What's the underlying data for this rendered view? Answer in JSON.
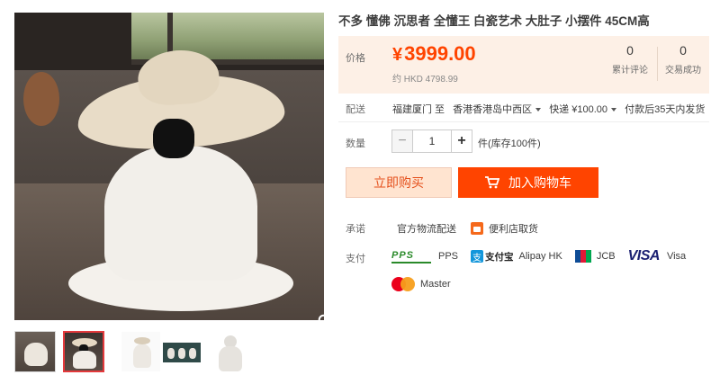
{
  "product": {
    "title": "不多 懂佛 沉思者 全懂王 白瓷艺术 大肚子 小摆件 45CM高"
  },
  "price_box": {
    "label": "价格",
    "currency": "¥",
    "price": "3999.00",
    "sub_price": "约 HKD 4798.99",
    "reviews_count": "0",
    "reviews_label": "累计评论",
    "sales_count": "0",
    "sales_label": "交易成功"
  },
  "shipping": {
    "label": "配送",
    "from": "福建厦门 至",
    "to": "香港香港岛中西区",
    "express": "快递 ¥100.00",
    "dispatch": "付款后35天内发货"
  },
  "quantity": {
    "label": "数量",
    "minus": "−",
    "value": "1",
    "plus": "+",
    "stock": "件(库存100件)"
  },
  "actions": {
    "buy_now": "立即购买",
    "add_to_cart": "加入购物车"
  },
  "promise": {
    "label": "承诺",
    "official_logistics": "官方物流配送",
    "store_pickup": "便利店取货"
  },
  "payment": {
    "label": "支付",
    "pps": "PPS",
    "alipay_logo_text": "支付宝",
    "alipay": "Alipay HK",
    "jcb": "JCB",
    "visa_logo": "VISA",
    "visa": "Visa",
    "master": "Master"
  },
  "gallery": {
    "thumbnails": 5,
    "active_index": 1
  },
  "colors": {
    "accent": "#ff4400",
    "price": "#ff4400",
    "price_bg": "#fdf0e6",
    "buy_now_bg": "#ffe4d0"
  }
}
